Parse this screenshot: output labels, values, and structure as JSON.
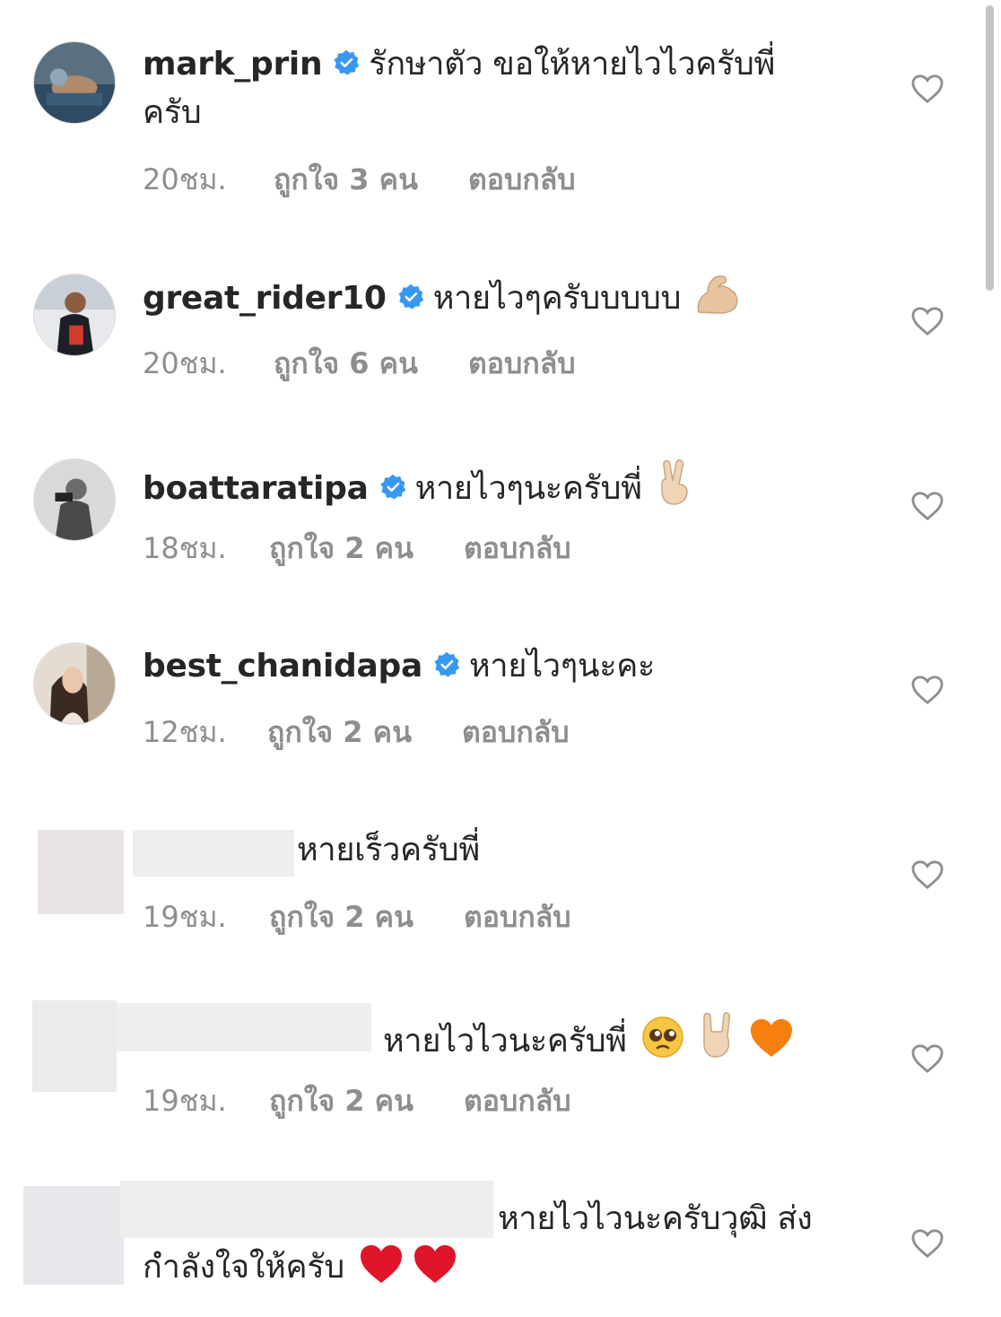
{
  "comments": [
    {
      "username": "mark_prin",
      "verified": true,
      "text": "รักษาตัว ขอให้หายไวไวครับพี่",
      "text_line2": "ครับ",
      "time": "20ชม.",
      "likes": "ถูกใจ 3 คน",
      "reply": "ตอบกลับ"
    },
    {
      "username": "great_rider10",
      "verified": true,
      "text": "หายไวๆครับบบบบ",
      "emojis": [
        "flexed-biceps"
      ],
      "time": "20ชม.",
      "likes": "ถูกใจ 6 คน",
      "reply": "ตอบกลับ"
    },
    {
      "username": "boattaratipa",
      "verified": true,
      "text": "หายไวๆนะครับพี่",
      "emojis": [
        "victory-hand"
      ],
      "time": "18ชม.",
      "likes": "ถูกใจ 2 คน",
      "reply": "ตอบกลับ"
    },
    {
      "username": "best_chanidapa",
      "verified": true,
      "text": "หายไวๆนะคะ",
      "time": "12ชม.",
      "likes": "ถูกใจ 2 คน",
      "reply": "ตอบกลับ"
    },
    {
      "username": "",
      "verified": false,
      "text": "หายเร็วครับพี่",
      "time": "19ชม.",
      "likes": "ถูกใจ 2 คน",
      "reply": "ตอบกลับ"
    },
    {
      "username": "",
      "verified": false,
      "text": "หายไวไวนะครับพี่",
      "emojis": [
        "pleading-face",
        "sign-of-horns",
        "orange-heart"
      ],
      "time": "19ชม.",
      "likes": "ถูกใจ 2 คน",
      "reply": "ตอบกลับ"
    },
    {
      "username": "",
      "verified": false,
      "text": "หายไวไวนะครับวุฒิ ส่ง",
      "text_line2": "กำลังใจให้ครับ",
      "emojis_line2": [
        "red-heart",
        "red-heart"
      ]
    }
  ],
  "colors": {
    "primary_text": "#262626",
    "secondary_text": "#8e8e8e",
    "verified_blue": "#3897f0",
    "heart_outline": "#8e8e8e",
    "red_heart": "#e0142b",
    "orange_heart": "#f77f10"
  }
}
